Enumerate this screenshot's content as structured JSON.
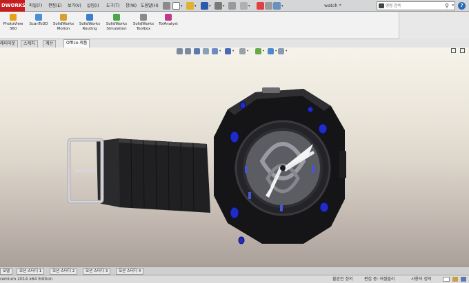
{
  "app": {
    "logo_text": "DWORKS",
    "document_title": "watch *",
    "colors": {
      "brand_red": "#c41e1e",
      "viewport_top": "#f6f3ea",
      "viewport_bottom": "#aaa09a",
      "watch_accent_blue": "#1f2cc8"
    }
  },
  "menubar": {
    "items": [
      {
        "label": "파일(F)"
      },
      {
        "label": "편집(E)"
      },
      {
        "label": "보기(V)"
      },
      {
        "label": "삽입(I)"
      },
      {
        "label": "도구(T)"
      },
      {
        "label": "창(W)"
      },
      {
        "label": "도움말(H)"
      }
    ]
  },
  "search": {
    "placeholder": "명령 검색",
    "icon": "search-icon",
    "help_label": "?"
  },
  "command_manager": {
    "items": [
      {
        "label": "PhotoView\n360",
        "icon": "photoview-icon",
        "color": "#e8a11a"
      },
      {
        "label": "ScanTo3D",
        "icon": "scanto3d-icon",
        "color": "#4a8fd8"
      },
      {
        "label": "SolidWorks\nMotion",
        "icon": "motion-icon",
        "color": "#d8a030"
      },
      {
        "label": "SolidWorks\nRouting",
        "icon": "routing-icon",
        "color": "#3d7fcf"
      },
      {
        "label": "SolidWorks\nSimulation",
        "icon": "simulation-icon",
        "color": "#4aa84a"
      },
      {
        "label": "SolidWorks\nToolbox",
        "icon": "toolbox-icon",
        "color": "#8a8a8a"
      },
      {
        "label": "TolAnalyst",
        "icon": "tolanalyst-icon",
        "color": "#c03a8a"
      }
    ]
  },
  "tabs": [
    {
      "label": "레이아웃",
      "active": false
    },
    {
      "label": "스케치",
      "active": false
    },
    {
      "label": "계산",
      "active": false
    },
    {
      "label": "Office 제품",
      "active": true
    }
  ],
  "sheet_tabs": [
    {
      "label": "모델"
    },
    {
      "label": "모션 스터디 1"
    },
    {
      "label": "모션 스터디 2"
    },
    {
      "label": "모션 스터디 3"
    },
    {
      "label": "모션 스터디 4"
    }
  ],
  "status": {
    "edition": "remium 2014 x64 Edition",
    "definition": "불완전 정의",
    "editing": "편집 중: 어셈블리",
    "user_defined": "사용자 정의"
  }
}
